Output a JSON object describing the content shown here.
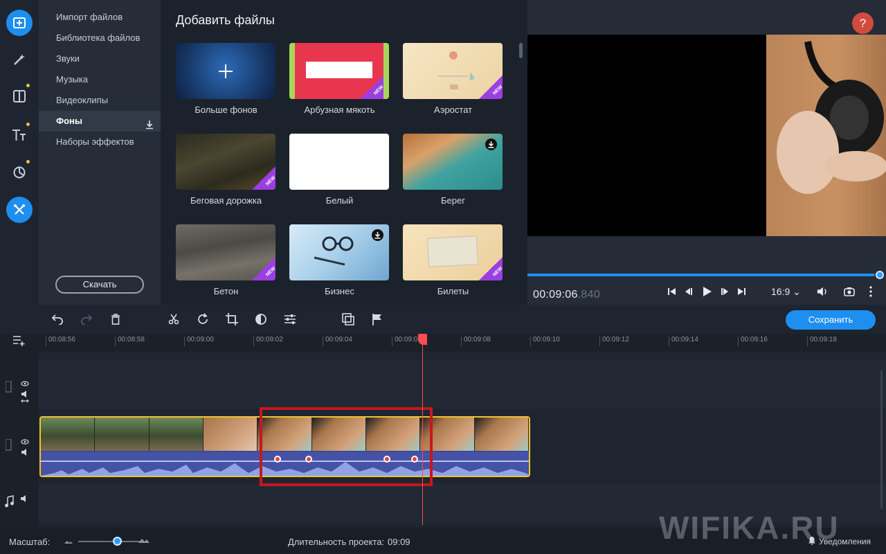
{
  "sidebar": {
    "rail_icons": [
      "add-files-icon",
      "magic-wand-icon",
      "transitions-icon",
      "titles-icon",
      "stickers-icon",
      "tools-icon"
    ],
    "categories": [
      {
        "label": "Импорт файлов"
      },
      {
        "label": "Библиотека файлов"
      },
      {
        "label": "Звуки"
      },
      {
        "label": "Музыка"
      },
      {
        "label": "Видеоклипы"
      },
      {
        "label": "Фоны"
      },
      {
        "label": "Наборы эффектов"
      }
    ],
    "active_category": "Фоны",
    "download_label": "Скачать"
  },
  "gallery": {
    "title": "Добавить файлы",
    "badge_new": "NEW",
    "items": [
      {
        "label": "Больше фонов",
        "badge": "",
        "bg": "#1f4f8f"
      },
      {
        "label": "Арбузная мякоть",
        "badge": "new",
        "bg": "#e8364e"
      },
      {
        "label": "Аэростат",
        "badge": "new",
        "bg": "#f3ddb4"
      },
      {
        "label": "Беговая дорожка",
        "badge": "new",
        "bg": "#3b3a2a"
      },
      {
        "label": "Белый",
        "badge": "",
        "bg": "#ffffff"
      },
      {
        "label": "Берег",
        "badge": "download",
        "bg": "#3aa6a4"
      },
      {
        "label": "Бетон",
        "badge": "new",
        "bg": "#5a5a58"
      },
      {
        "label": "Бизнес",
        "badge": "download",
        "bg": "#9fc7e6"
      },
      {
        "label": "Билеты",
        "badge": "new",
        "bg": "#f1dcb3"
      }
    ]
  },
  "preview": {
    "help_label": "?",
    "timecode_main": "00:09:06",
    "timecode_ms": ".840",
    "aspect_ratio": "16:9 ⌄",
    "progress_fraction": 0.985
  },
  "toolbar": {
    "save_label": "Сохранить"
  },
  "timeline": {
    "ticks": [
      "00:08:56",
      "00:08:58",
      "00:09:00",
      "00:09:02",
      "00:09:04",
      "00:09:06",
      "00:09:08",
      "00:09:10",
      "00:09:12",
      "00:09:14",
      "00:09:16",
      "00:09:18"
    ]
  },
  "status": {
    "scale_label": "Масштаб:",
    "duration_label": "Длительность проекта:",
    "duration_value": "09:09",
    "notifications_label": "Уведомления",
    "watermark": "WIFIKA.RU"
  },
  "colors": {
    "accent": "#1e8eef",
    "clip_border": "#f4c430",
    "highlight": "#c8171b",
    "playhead": "#ff4d4d"
  }
}
